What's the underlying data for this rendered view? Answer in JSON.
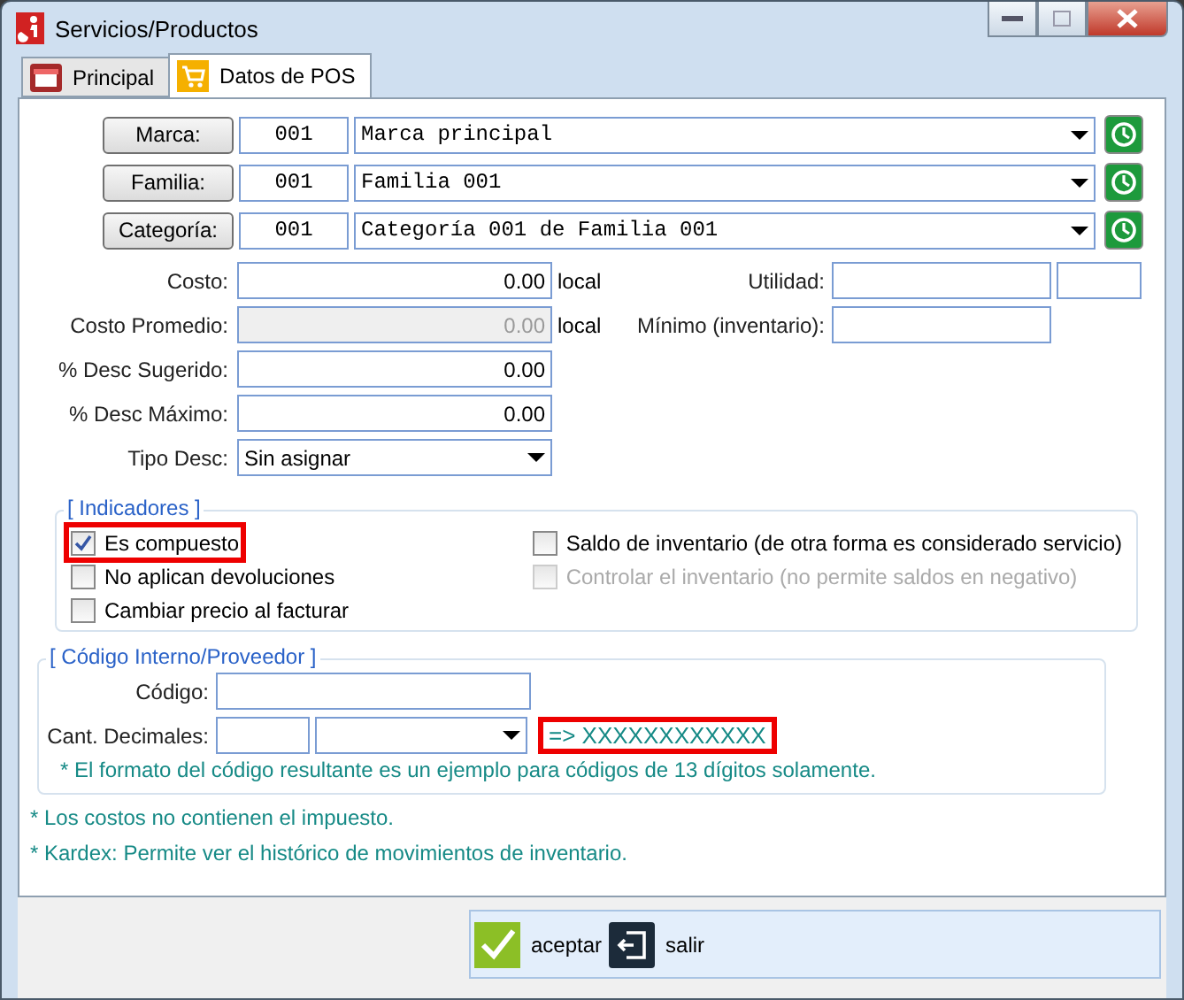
{
  "window": {
    "title": "Servicios/Productos"
  },
  "tabs": [
    {
      "label": "Principal",
      "selected": false
    },
    {
      "label": "Datos de POS",
      "selected": true
    }
  ],
  "lookups": [
    {
      "button": "Marca:",
      "code": "001",
      "value": "Marca principal"
    },
    {
      "button": "Familia:",
      "code": "001",
      "value": "Familia 001"
    },
    {
      "button": "Categoría:",
      "code": "001",
      "value": "Categoría 001 de Familia 001"
    }
  ],
  "costs": [
    {
      "label": "Costo:",
      "value": "0.00",
      "disabled": false,
      "unit": "local",
      "right_label": "Utilidad:",
      "extra_field": true
    },
    {
      "label": "Costo Promedio:",
      "value": "0.00",
      "disabled": true,
      "unit": "local",
      "right_label": "Mínimo (inventario):",
      "extra_field": false
    },
    {
      "label": "% Desc Sugerido:",
      "value": "0.00",
      "disabled": false
    },
    {
      "label": "% Desc Máximo:",
      "value": "0.00",
      "disabled": false
    }
  ],
  "tipo_desc": {
    "label": "Tipo Desc:",
    "value": "Sin asignar"
  },
  "indicadores": {
    "title": "[ Indicadores ]",
    "left": [
      {
        "label": "Es compuesto",
        "checked": true,
        "disabled": false,
        "highlighted": true
      },
      {
        "label": "No aplican devoluciones",
        "checked": false,
        "disabled": false,
        "highlighted": false
      },
      {
        "label": "Cambiar precio al facturar",
        "checked": false,
        "disabled": false,
        "highlighted": false
      }
    ],
    "right": [
      {
        "label": "Saldo de inventario (de otra forma es considerado servicio)",
        "checked": false,
        "disabled": false,
        "highlighted": false
      },
      {
        "label": "Controlar el inventario (no permite saldos en negativo)",
        "checked": false,
        "disabled": true,
        "highlighted": false
      }
    ]
  },
  "codigo": {
    "title": "[ Código Interno/Proveedor ]",
    "code_label": "Código:",
    "decimals_label": "Cant. Decimales:",
    "result": "=> XXXXXXXXXXXX",
    "result_highlighted": true,
    "note": "* El formato del código resultante es un ejemplo para códigos de 13 dígitos solamente."
  },
  "notes": [
    "* Los costos no contienen el impuesto.",
    "* Kardex: Permite ver el histórico de movimientos de inventario."
  ],
  "buttons": [
    {
      "kind": "accept",
      "label": "aceptar"
    },
    {
      "kind": "exit",
      "label": "salir"
    }
  ]
}
